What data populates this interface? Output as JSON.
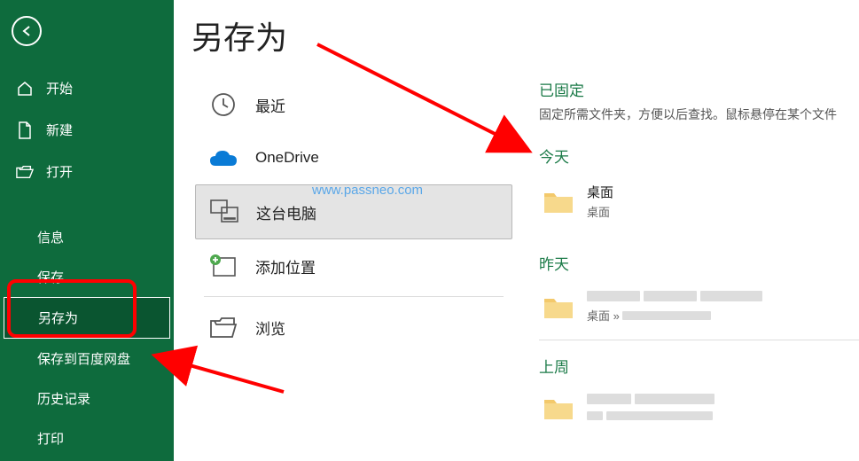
{
  "sidebar": {
    "items": [
      {
        "label": "开始",
        "icon": "home-icon"
      },
      {
        "label": "新建",
        "icon": "file-icon"
      },
      {
        "label": "打开",
        "icon": "folder-open-icon"
      }
    ],
    "subitems": [
      {
        "label": "信息"
      },
      {
        "label": "保存"
      },
      {
        "label": "另存为",
        "selected": true
      },
      {
        "label": "保存到百度网盘"
      },
      {
        "label": "历史记录"
      },
      {
        "label": "打印"
      }
    ]
  },
  "main": {
    "title": "另存为",
    "locations": [
      {
        "label": "最近",
        "icon": "clock-icon"
      },
      {
        "label": "OneDrive",
        "icon": "onedrive-icon"
      },
      {
        "label": "这台电脑",
        "icon": "thispc-icon",
        "selected": true
      },
      {
        "label": "添加位置",
        "icon": "add-location-icon"
      },
      {
        "label": "浏览",
        "icon": "browse-folder-icon"
      }
    ],
    "pinned": {
      "title": "已固定",
      "subtitle": "固定所需文件夹，方便以后查找。鼠标悬停在某个文件"
    },
    "groups": [
      {
        "label": "今天",
        "folders": [
          {
            "name": "桌面",
            "path": "桌面"
          }
        ]
      },
      {
        "label": "昨天",
        "folders": [
          {
            "name": "_blurred_",
            "path": "桌面 »"
          }
        ]
      },
      {
        "label": "上周",
        "folders": [
          {
            "name": "_blurred_",
            "path": "_blurred_"
          }
        ]
      }
    ]
  },
  "watermark": "www.passneo.com"
}
